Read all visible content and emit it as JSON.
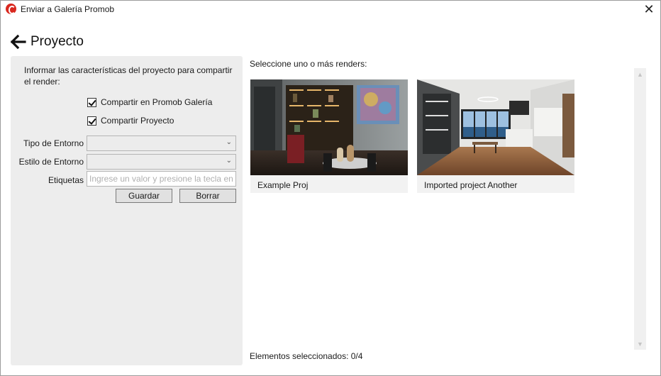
{
  "window": {
    "title": "Enviar a Galería Promob",
    "icon": "promob-logo-icon",
    "close_glyph": "✕"
  },
  "header": {
    "back_icon": "arrow-left-icon",
    "title": "Proyecto"
  },
  "form": {
    "intro": "Informar las características del proyecto para compartir el render:",
    "share_gallery": {
      "label": "Compartir en Promob Galería",
      "checked": true
    },
    "share_project": {
      "label": "Compartir Proyecto",
      "checked": true
    },
    "environment_type": {
      "label": "Tipo de Entorno",
      "value": ""
    },
    "environment_style": {
      "label": "Estilo de Entorno",
      "value": ""
    },
    "tags": {
      "label": "Etiquetas",
      "value": "",
      "placeholder": "Ingrese un valor y presione la tecla enter"
    },
    "save_label": "Guardar",
    "clear_label": "Borrar"
  },
  "renders": {
    "prompt": "Seleccione uno o más renders:",
    "items": [
      {
        "caption": "Example Proj"
      },
      {
        "caption": "Imported project Another"
      }
    ],
    "selected_count": "Elementos seleccionados: 0/4"
  },
  "colors": {
    "brand": "#d9281f",
    "panel_bg": "#ededed",
    "button_bg": "#e1e1e1"
  }
}
